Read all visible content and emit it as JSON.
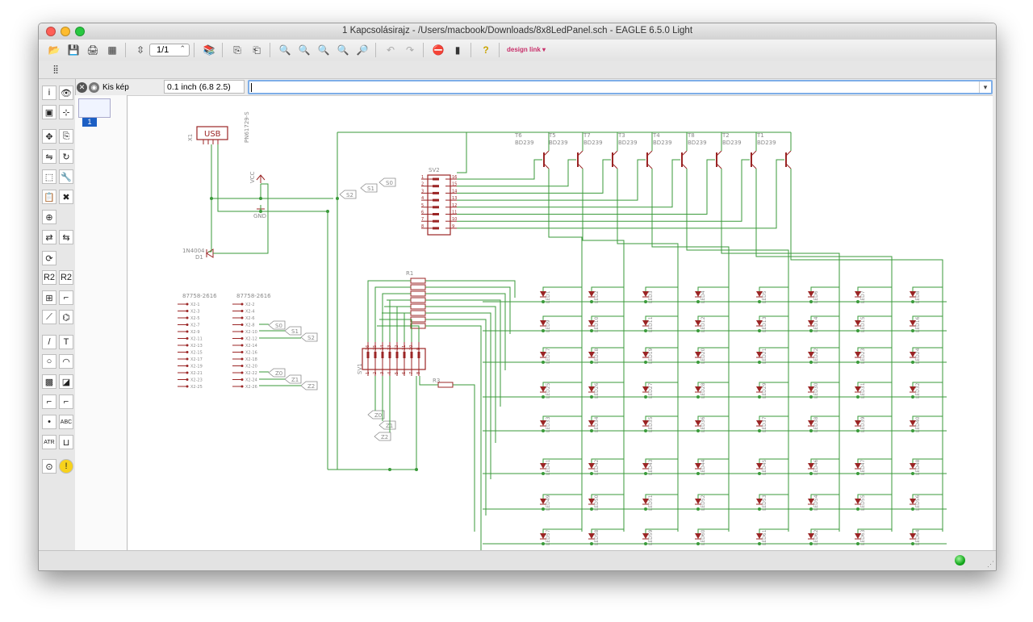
{
  "window": {
    "title": "1 Kapcsolásirajz - /Users/macbook/Downloads/8x8LedPanel.sch - EAGLE 6.5.0 Light"
  },
  "toolbar": {
    "sheet_select": "1/1",
    "design_link": "design link"
  },
  "command_bar": {
    "close_button": "✕",
    "preview_button": "Kis kép",
    "grid_info": "0.1 inch (6.8 2.5)",
    "command_value": ""
  },
  "sheet_panel": {
    "page_badge": "1"
  },
  "schematic": {
    "usb": {
      "name": "X1",
      "label": "USB",
      "part": "PN61729-S"
    },
    "vcc_label": "VCC",
    "gnd_label": "GND",
    "diode": {
      "part": "1N4004",
      "name": "D1"
    },
    "connector_sv2": {
      "name": "SV2",
      "left_pins": [
        "1",
        "2",
        "3",
        "4",
        "5",
        "6",
        "7",
        "8"
      ],
      "right_pins": [
        "16",
        "15",
        "14",
        "13",
        "12",
        "11",
        "10",
        "9"
      ]
    },
    "connector_sv1": {
      "name": "SV1",
      "top_pins": [
        "16",
        "15",
        "14",
        "13",
        "12",
        "11",
        "10",
        "9"
      ],
      "bottom_pins": [
        "1",
        "2",
        "3",
        "4",
        "5",
        "6",
        "7",
        "8"
      ]
    },
    "labels_sv2": [
      "S0",
      "S1",
      "S2"
    ],
    "resistor_r1": "R1",
    "resistor_r3": "R3",
    "header_left": {
      "title": "87758-2616",
      "pins": [
        "X2-1",
        "X2-3",
        "X2-5",
        "X2-7",
        "X2-9",
        "X2-11",
        "X2-13",
        "X2-15",
        "X2-17",
        "X2-19",
        "X2-21",
        "X2-23",
        "X2-25"
      ]
    },
    "header_right": {
      "title": "87758-2616",
      "pins": [
        "X2-2",
        "X2-4",
        "X2-6",
        "X2-8",
        "X2-10",
        "X2-12",
        "X2-14",
        "X2-16",
        "X2-18",
        "X2-20",
        "X2-22",
        "X2-24",
        "X2-26"
      ]
    },
    "labels_x2": [
      "S0",
      "S1",
      "S2",
      "Z0",
      "Z1",
      "Z2"
    ],
    "labels_sv1": [
      "Z0",
      "Z1",
      "Z2"
    ],
    "transistors": [
      {
        "name": "T6",
        "part": "BD239"
      },
      {
        "name": "T5",
        "part": "BD239"
      },
      {
        "name": "T7",
        "part": "BD239"
      },
      {
        "name": "T3",
        "part": "BD239"
      },
      {
        "name": "T4",
        "part": "BD239"
      },
      {
        "name": "T8",
        "part": "BD239"
      },
      {
        "name": "T2",
        "part": "BD239"
      },
      {
        "name": "T1",
        "part": "BD239"
      }
    ],
    "led_matrix": {
      "rows": 8,
      "cols": 8,
      "prefix": "LED"
    }
  },
  "colors": {
    "wire": "#3a9a3a",
    "part": "#9b2525",
    "label": "#8a8a8a",
    "accent": "#1c5fc4"
  },
  "status": {
    "indicator": "ok"
  }
}
